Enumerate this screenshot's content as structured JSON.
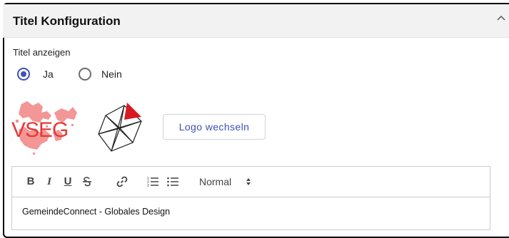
{
  "section": {
    "title": "Titel Konfiguration",
    "collapse_icon": "chevron-up-icon"
  },
  "title_display": {
    "label": "Titel anzeigen",
    "options": [
      {
        "label": "Ja",
        "selected": true
      },
      {
        "label": "Nein",
        "selected": false
      }
    ]
  },
  "logos": {
    "primary_text": "VSEG",
    "primary_color": "#e53935",
    "accent_color": "#d71920"
  },
  "change_logo_button": {
    "label": "Logo wechseln"
  },
  "editor": {
    "toolbar": {
      "bold": "B",
      "italic": "I",
      "underline": "U",
      "strike": "strike-icon",
      "link": "link-icon",
      "ordered_list": "ordered-list-icon",
      "bullet_list": "bullet-list-icon",
      "header_select": "Normal"
    },
    "content": "GemeindeConnect - Globales Design"
  },
  "colors": {
    "accent": "#3f51b5",
    "header_bg": "#f2f2f2"
  }
}
